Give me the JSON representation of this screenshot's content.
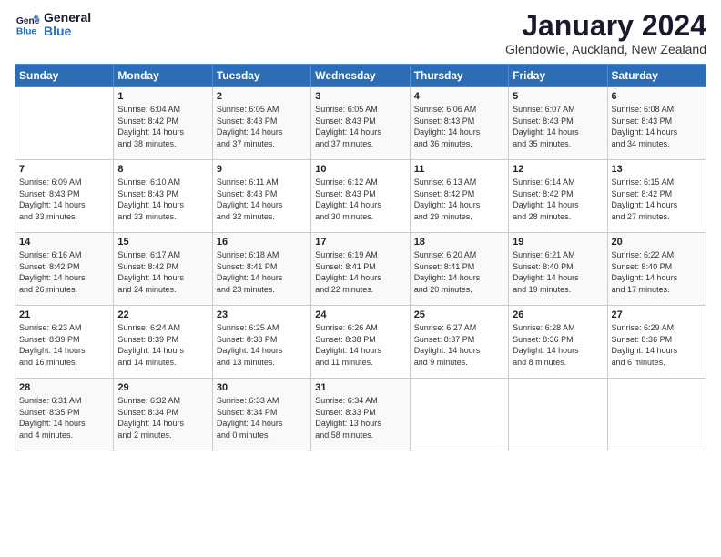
{
  "logo": {
    "line1": "General",
    "line2": "Blue"
  },
  "title": "January 2024",
  "location": "Glendowie, Auckland, New Zealand",
  "days_of_week": [
    "Sunday",
    "Monday",
    "Tuesday",
    "Wednesday",
    "Thursday",
    "Friday",
    "Saturday"
  ],
  "weeks": [
    [
      {
        "day": "",
        "sunrise": "",
        "sunset": "",
        "daylight": ""
      },
      {
        "day": "1",
        "sunrise": "6:04 AM",
        "sunset": "8:42 PM",
        "daylight": "14 hours and 38 minutes."
      },
      {
        "day": "2",
        "sunrise": "6:05 AM",
        "sunset": "8:43 PM",
        "daylight": "14 hours and 37 minutes."
      },
      {
        "day": "3",
        "sunrise": "6:05 AM",
        "sunset": "8:43 PM",
        "daylight": "14 hours and 37 minutes."
      },
      {
        "day": "4",
        "sunrise": "6:06 AM",
        "sunset": "8:43 PM",
        "daylight": "14 hours and 36 minutes."
      },
      {
        "day": "5",
        "sunrise": "6:07 AM",
        "sunset": "8:43 PM",
        "daylight": "14 hours and 35 minutes."
      },
      {
        "day": "6",
        "sunrise": "6:08 AM",
        "sunset": "8:43 PM",
        "daylight": "14 hours and 34 minutes."
      }
    ],
    [
      {
        "day": "7",
        "sunrise": "6:09 AM",
        "sunset": "8:43 PM",
        "daylight": "14 hours and 33 minutes."
      },
      {
        "day": "8",
        "sunrise": "6:10 AM",
        "sunset": "8:43 PM",
        "daylight": "14 hours and 33 minutes."
      },
      {
        "day": "9",
        "sunrise": "6:11 AM",
        "sunset": "8:43 PM",
        "daylight": "14 hours and 32 minutes."
      },
      {
        "day": "10",
        "sunrise": "6:12 AM",
        "sunset": "8:43 PM",
        "daylight": "14 hours and 30 minutes."
      },
      {
        "day": "11",
        "sunrise": "6:13 AM",
        "sunset": "8:42 PM",
        "daylight": "14 hours and 29 minutes."
      },
      {
        "day": "12",
        "sunrise": "6:14 AM",
        "sunset": "8:42 PM",
        "daylight": "14 hours and 28 minutes."
      },
      {
        "day": "13",
        "sunrise": "6:15 AM",
        "sunset": "8:42 PM",
        "daylight": "14 hours and 27 minutes."
      }
    ],
    [
      {
        "day": "14",
        "sunrise": "6:16 AM",
        "sunset": "8:42 PM",
        "daylight": "14 hours and 26 minutes."
      },
      {
        "day": "15",
        "sunrise": "6:17 AM",
        "sunset": "8:42 PM",
        "daylight": "14 hours and 24 minutes."
      },
      {
        "day": "16",
        "sunrise": "6:18 AM",
        "sunset": "8:41 PM",
        "daylight": "14 hours and 23 minutes."
      },
      {
        "day": "17",
        "sunrise": "6:19 AM",
        "sunset": "8:41 PM",
        "daylight": "14 hours and 22 minutes."
      },
      {
        "day": "18",
        "sunrise": "6:20 AM",
        "sunset": "8:41 PM",
        "daylight": "14 hours and 20 minutes."
      },
      {
        "day": "19",
        "sunrise": "6:21 AM",
        "sunset": "8:40 PM",
        "daylight": "14 hours and 19 minutes."
      },
      {
        "day": "20",
        "sunrise": "6:22 AM",
        "sunset": "8:40 PM",
        "daylight": "14 hours and 17 minutes."
      }
    ],
    [
      {
        "day": "21",
        "sunrise": "6:23 AM",
        "sunset": "8:39 PM",
        "daylight": "14 hours and 16 minutes."
      },
      {
        "day": "22",
        "sunrise": "6:24 AM",
        "sunset": "8:39 PM",
        "daylight": "14 hours and 14 minutes."
      },
      {
        "day": "23",
        "sunrise": "6:25 AM",
        "sunset": "8:38 PM",
        "daylight": "14 hours and 13 minutes."
      },
      {
        "day": "24",
        "sunrise": "6:26 AM",
        "sunset": "8:38 PM",
        "daylight": "14 hours and 11 minutes."
      },
      {
        "day": "25",
        "sunrise": "6:27 AM",
        "sunset": "8:37 PM",
        "daylight": "14 hours and 9 minutes."
      },
      {
        "day": "26",
        "sunrise": "6:28 AM",
        "sunset": "8:36 PM",
        "daylight": "14 hours and 8 minutes."
      },
      {
        "day": "27",
        "sunrise": "6:29 AM",
        "sunset": "8:36 PM",
        "daylight": "14 hours and 6 minutes."
      }
    ],
    [
      {
        "day": "28",
        "sunrise": "6:31 AM",
        "sunset": "8:35 PM",
        "daylight": "14 hours and 4 minutes."
      },
      {
        "day": "29",
        "sunrise": "6:32 AM",
        "sunset": "8:34 PM",
        "daylight": "14 hours and 2 minutes."
      },
      {
        "day": "30",
        "sunrise": "6:33 AM",
        "sunset": "8:34 PM",
        "daylight": "14 hours and 0 minutes."
      },
      {
        "day": "31",
        "sunrise": "6:34 AM",
        "sunset": "8:33 PM",
        "daylight": "13 hours and 58 minutes."
      },
      {
        "day": "",
        "sunrise": "",
        "sunset": "",
        "daylight": ""
      },
      {
        "day": "",
        "sunrise": "",
        "sunset": "",
        "daylight": ""
      },
      {
        "day": "",
        "sunrise": "",
        "sunset": "",
        "daylight": ""
      }
    ]
  ],
  "labels": {
    "sunrise_prefix": "Sunrise: ",
    "sunset_prefix": "Sunset: ",
    "daylight_prefix": "Daylight: "
  }
}
